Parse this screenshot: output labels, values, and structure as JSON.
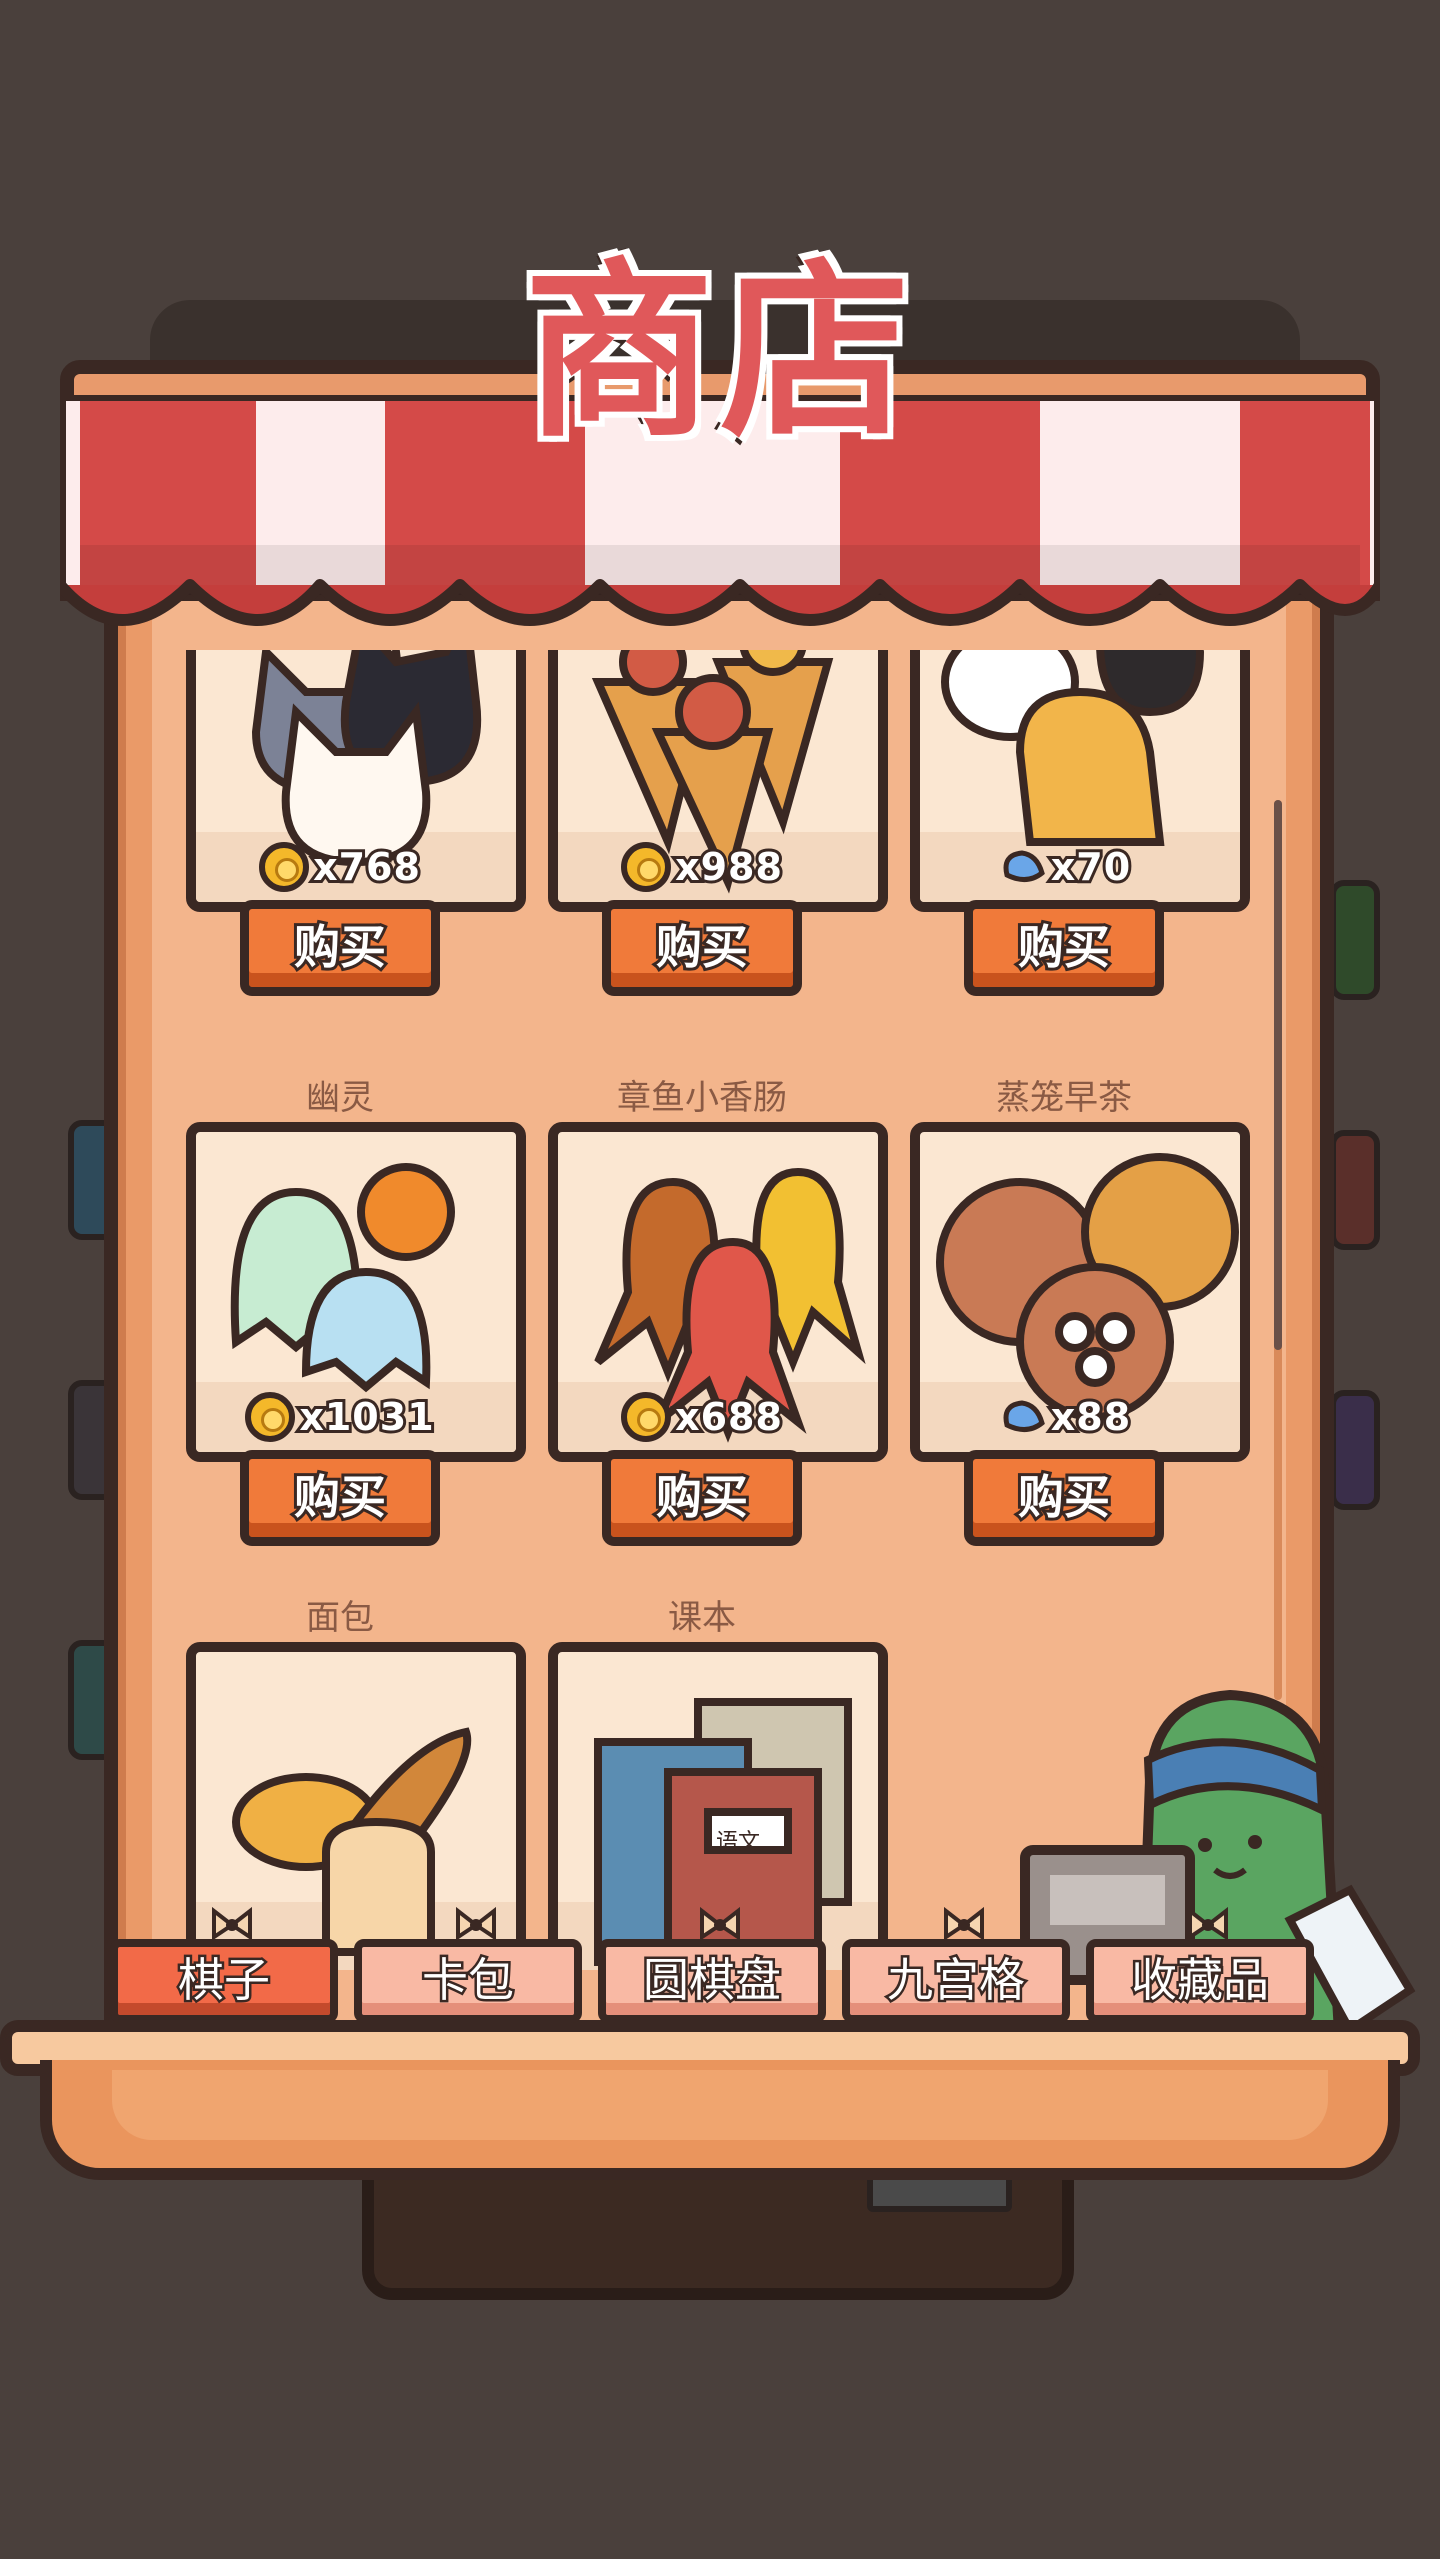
{
  "shop": {
    "title": "商店"
  },
  "items": [
    {
      "name": "",
      "currency": "coin",
      "price": "x768",
      "buy_label": "购买",
      "art": "cats"
    },
    {
      "name": "",
      "currency": "coin",
      "price": "x988",
      "buy_label": "购买",
      "art": "taiyaki-cones"
    },
    {
      "name": "",
      "currency": "gem",
      "price": "x70",
      "buy_label": "购买",
      "art": "dogs"
    },
    {
      "name": "幽灵",
      "currency": "coin",
      "price": "x1031",
      "buy_label": "购买",
      "art": "ghosts"
    },
    {
      "name": "章鱼小香肠",
      "currency": "coin",
      "price": "x688",
      "buy_label": "购买",
      "art": "octopus-sausages"
    },
    {
      "name": "蒸笼早茶",
      "currency": "gem",
      "price": "x88",
      "buy_label": "购买",
      "art": "dim-sum-steamers"
    },
    {
      "name": "面包",
      "currency": "coin",
      "price": "",
      "buy_label": "",
      "art": "bread"
    },
    {
      "name": "课本",
      "currency": "coin",
      "price": "",
      "buy_label": "",
      "art": "textbooks",
      "book_label": "语文"
    }
  ],
  "tabs": [
    {
      "label": "棋子",
      "active": true
    },
    {
      "label": "卡包",
      "active": false
    },
    {
      "label": "圆棋盘",
      "active": false
    },
    {
      "label": "九宫格",
      "active": false
    },
    {
      "label": "收藏品",
      "active": false
    }
  ],
  "colors": {
    "accent": "#f07a3a",
    "title": "#e0585a",
    "outline": "#3a2823",
    "coin": "#f4b82a",
    "gem": "#6aa6e8"
  }
}
